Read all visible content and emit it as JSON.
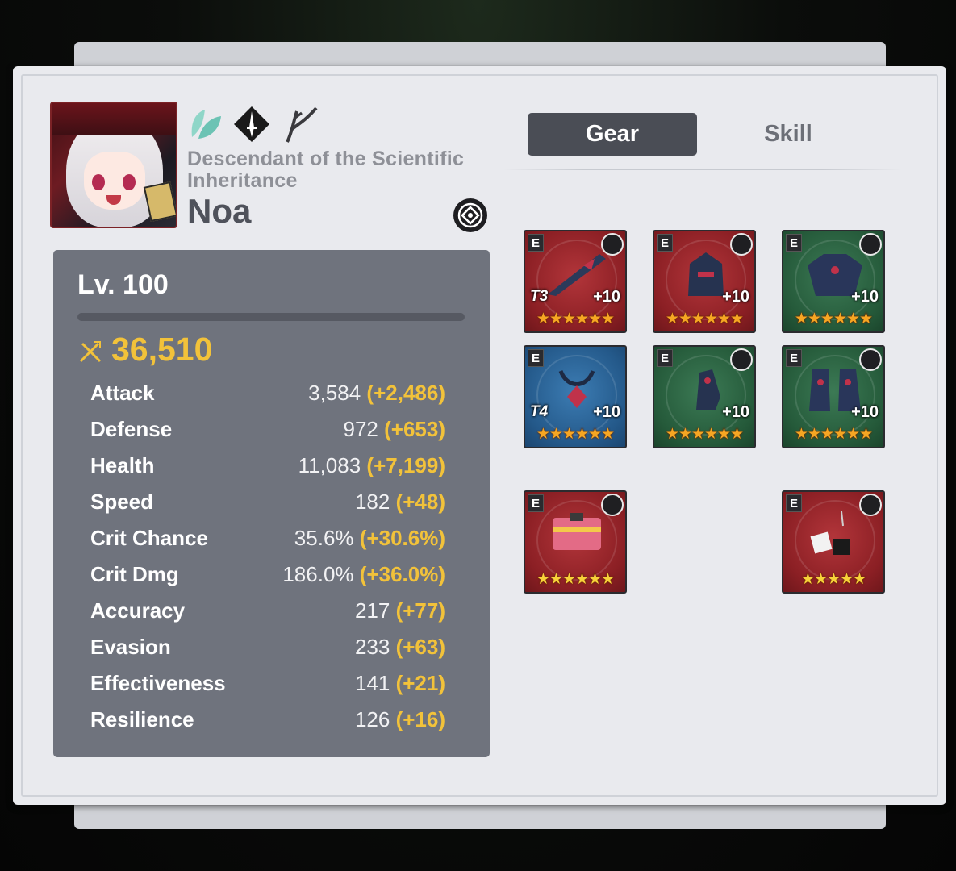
{
  "hero": {
    "title": "Descendant of the Scientific Inheritance",
    "name": "Noa",
    "element_icon": "leaf-element-icon",
    "class_icon": "thief-class-icon",
    "horoscope_icon": "horoscope-icon",
    "imprint_icon": "imprint-target-icon"
  },
  "tabs": {
    "gear": "Gear",
    "skill": "Skill"
  },
  "stats": {
    "level": "Lv. 100",
    "combat_power": "36,510",
    "rows": [
      {
        "label": "Attack",
        "value": "3,584",
        "bonus": "(+2,486)"
      },
      {
        "label": "Defense",
        "value": "972",
        "bonus": "(+653)"
      },
      {
        "label": "Health",
        "value": "11,083",
        "bonus": "(+7,199)"
      },
      {
        "label": "Speed",
        "value": "182",
        "bonus": "(+48)"
      },
      {
        "label": "Crit Chance",
        "value": "35.6%",
        "bonus": "(+30.6%)"
      },
      {
        "label": "Crit Dmg",
        "value": "186.0%",
        "bonus": "(+36.0%)"
      },
      {
        "label": "Accuracy",
        "value": "217",
        "bonus": "(+77)"
      },
      {
        "label": "Evasion",
        "value": "233",
        "bonus": "(+63)"
      },
      {
        "label": "Effectiveness",
        "value": "141",
        "bonus": "(+21)"
      },
      {
        "label": "Resilience",
        "value": "126",
        "bonus": "(+16)"
      }
    ]
  },
  "gear": [
    {
      "slot": "weapon",
      "grade": "E",
      "tier": "T3",
      "enh": "+10",
      "stars": "★★★★★★",
      "color": "red"
    },
    {
      "slot": "helmet",
      "grade": "E",
      "tier": "",
      "enh": "+10",
      "stars": "★★★★★★",
      "color": "red"
    },
    {
      "slot": "armor",
      "grade": "E",
      "tier": "",
      "enh": "+10",
      "stars": "★★★★★★",
      "color": "green"
    },
    {
      "slot": "necklace",
      "grade": "E",
      "tier": "T4",
      "enh": "+10",
      "stars": "★★★★★★",
      "color": "blue"
    },
    {
      "slot": "ring",
      "grade": "E",
      "tier": "",
      "enh": "+10",
      "stars": "★★★★★★",
      "color": "green"
    },
    {
      "slot": "boots",
      "grade": "E",
      "tier": "",
      "enh": "+10",
      "stars": "★★★★★★",
      "color": "green"
    }
  ],
  "artifacts": [
    {
      "grade": "E",
      "stars": "★★★★★★"
    },
    {
      "grade": "E",
      "stars": "★★★★★"
    }
  ]
}
